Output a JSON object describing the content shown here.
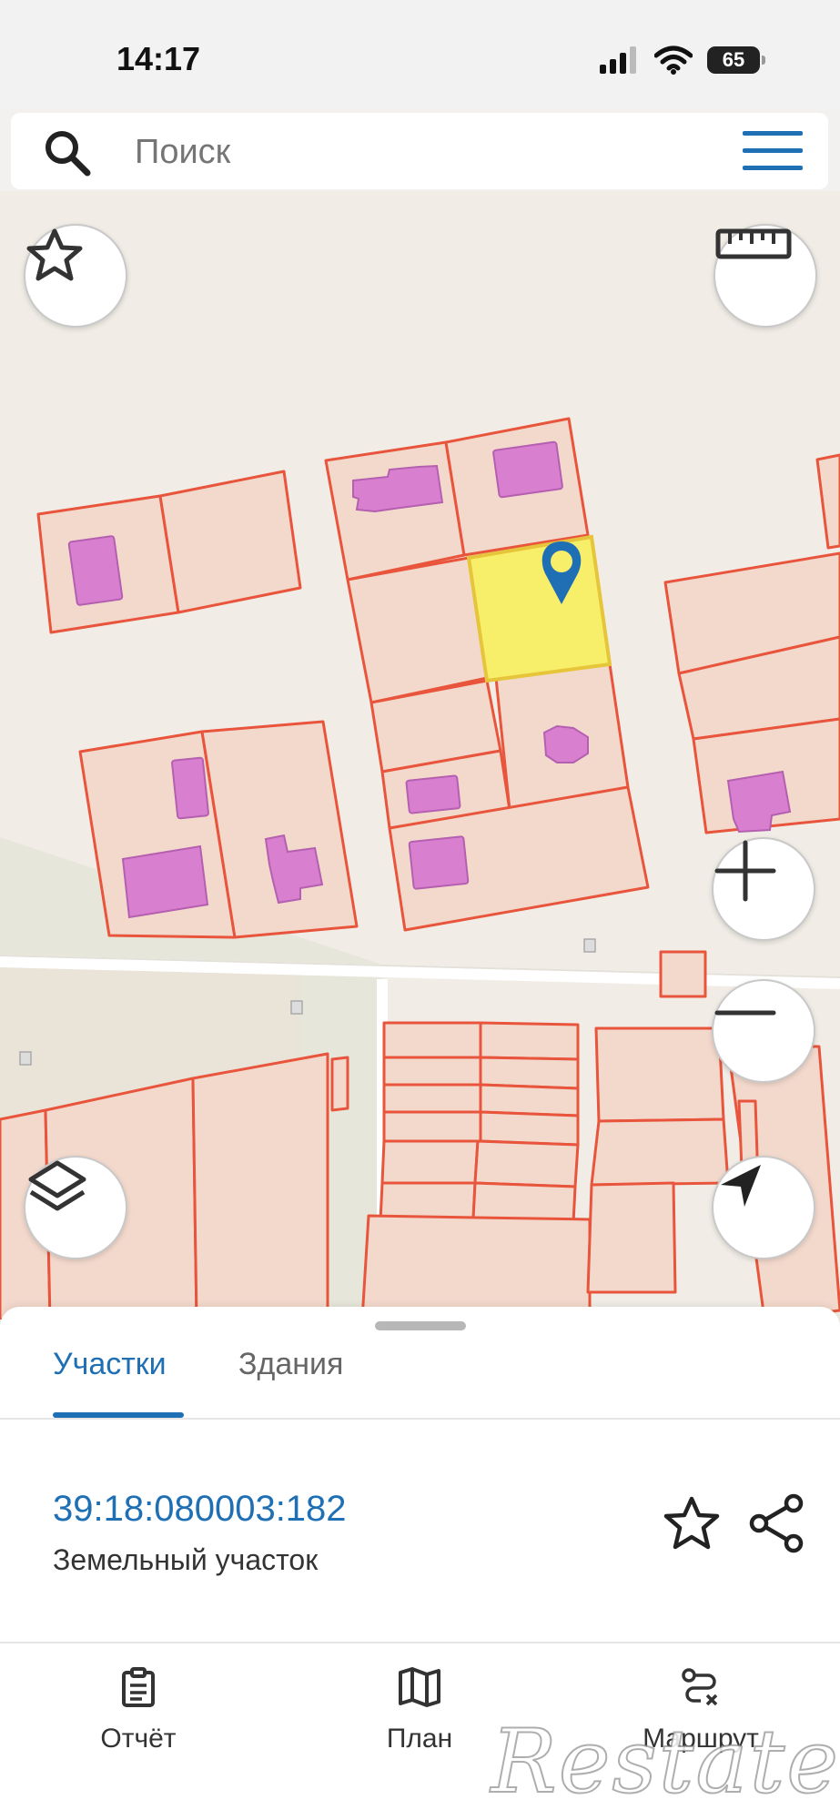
{
  "status_bar": {
    "time": "14:17",
    "battery": "65"
  },
  "search": {
    "placeholder": "Поиск"
  },
  "sheet": {
    "tabs": [
      {
        "label": "Участки",
        "active": true
      },
      {
        "label": "Здания",
        "active": false
      }
    ],
    "parcel": {
      "cadastral_number": "39:18:080003:182",
      "type": "Земельный участок"
    }
  },
  "nav": {
    "items": [
      {
        "label": "Отчёт",
        "icon": "report-icon"
      },
      {
        "label": "План",
        "icon": "map-icon"
      },
      {
        "label": "Маршрут",
        "icon": "route-icon"
      }
    ]
  },
  "watermark": "Restate",
  "colors": {
    "accent": "#1f6fb5",
    "parcel_stroke": "#e8553c",
    "parcel_fill": "#f3d9cc",
    "building_fill": "#d97fd0",
    "selected_fill": "#f7ef6a",
    "map_background": "#f1ede6"
  }
}
